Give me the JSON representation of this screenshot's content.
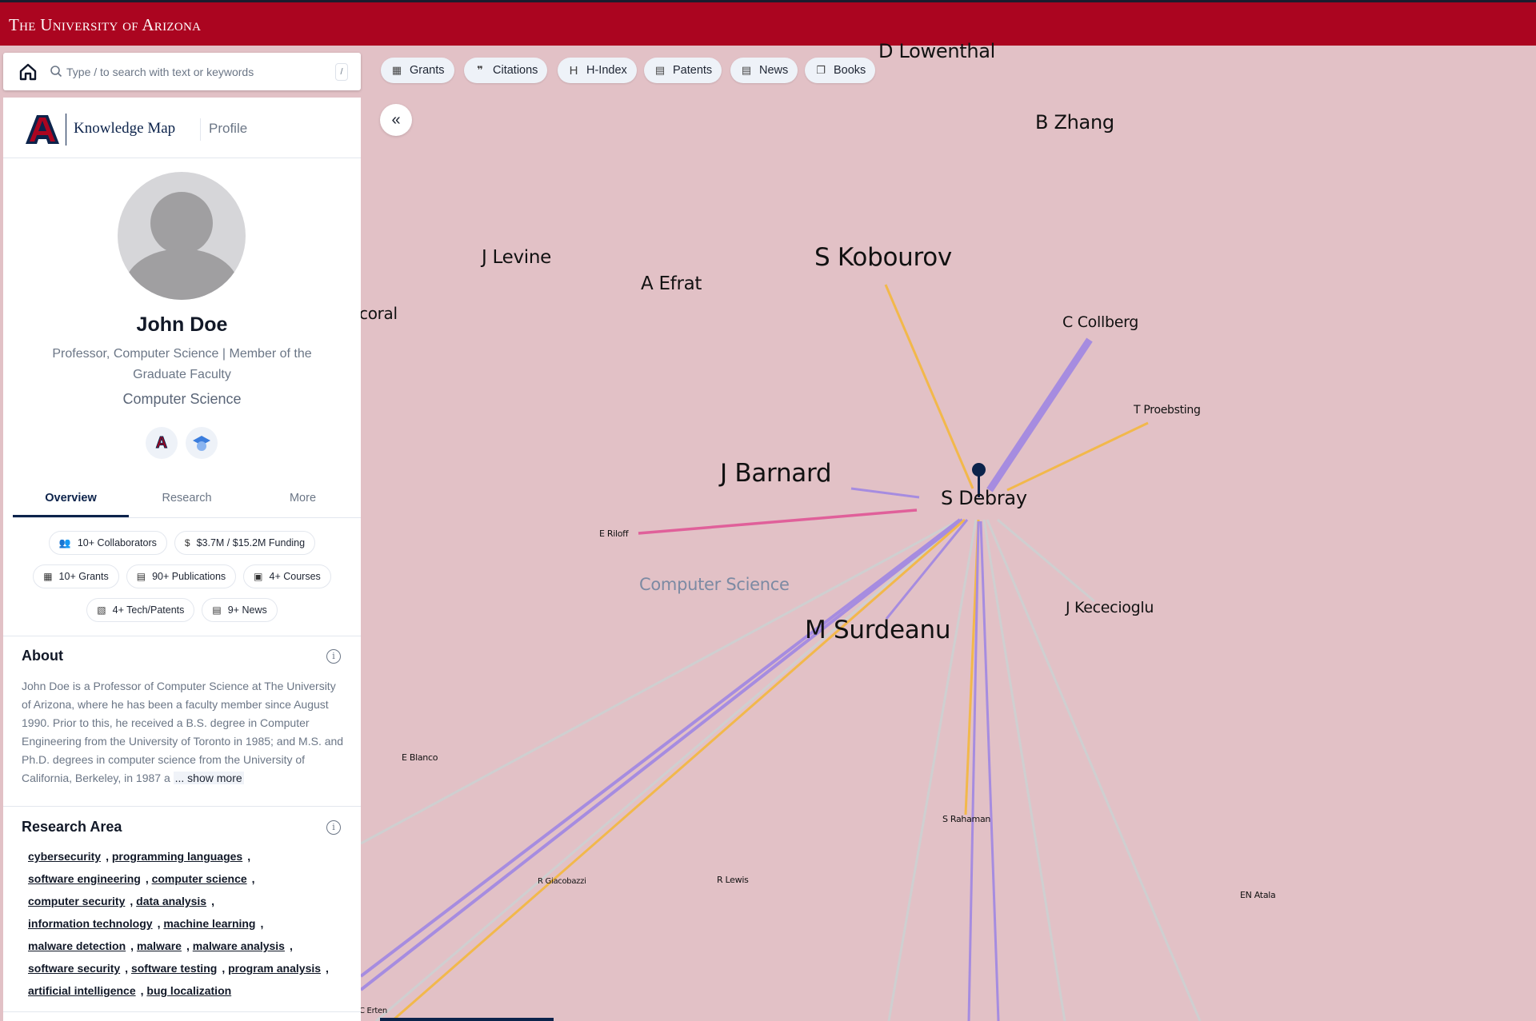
{
  "header": {
    "brand": "The University of Arizona"
  },
  "search": {
    "placeholder": "Type / to search with text or keywords",
    "value": "",
    "shortcut": "/"
  },
  "logo": {
    "app_name": "Knowledge Map",
    "section": "Profile"
  },
  "profile": {
    "name": "John Doe",
    "title": "Professor, Computer Science | Member of the Graduate Faculty",
    "department": "Computer Science",
    "badges": [
      "arizona-a-icon",
      "graduation-cap-icon"
    ]
  },
  "tabs": [
    {
      "label": "Overview",
      "active": true
    },
    {
      "label": "Research",
      "active": false
    },
    {
      "label": "More",
      "active": false
    }
  ],
  "stats": [
    {
      "icon": "collaborators-icon",
      "label": "10+ Collaborators"
    },
    {
      "icon": "dollar-icon",
      "label": "$3.7M / $15.2M Funding"
    },
    {
      "icon": "grants-icon",
      "label": "10+ Grants"
    },
    {
      "icon": "publications-icon",
      "label": "90+ Publications"
    },
    {
      "icon": "courses-icon",
      "label": "4+ Courses"
    },
    {
      "icon": "patents-icon",
      "label": "4+ Tech/Patents"
    },
    {
      "icon": "news-icon",
      "label": "9+ News"
    }
  ],
  "about": {
    "heading": "About",
    "text": "John Doe is a Professor of Computer Science at The University of Arizona, where he has been a faculty member since August 1990. Prior to this, he received a B.S. degree in Computer Engineering from the University of Toronto in 1985; and M.S. and Ph.D. degrees in computer science from the University of California, Berkeley, in 1987 a",
    "show_more": "... show more"
  },
  "research_area": {
    "heading": "Research Area",
    "tags": [
      "cybersecurity",
      "programming languages",
      "software engineering",
      "computer science",
      "computer security",
      "data analysis",
      "information technology",
      "machine learning",
      "malware detection",
      "malware",
      "malware analysis",
      "software security",
      "software testing",
      "program analysis",
      "artificial intelligence",
      "bug localization"
    ]
  },
  "toolbar": [
    {
      "icon": "grants-icon",
      "label": "Grants"
    },
    {
      "icon": "quote-icon",
      "label": "Citations"
    },
    {
      "icon": "h-icon",
      "label": "H-Index"
    },
    {
      "icon": "patent-icon",
      "label": "Patents"
    },
    {
      "icon": "news-icon",
      "label": "News"
    },
    {
      "icon": "books-icon",
      "label": "Books"
    }
  ],
  "map": {
    "center_node": "S Debray",
    "cluster_label": "Computer Science",
    "nodes": [
      "D Lowenthal",
      "B Zhang",
      "J Levine",
      "A Efrat",
      "S Kobourov",
      "coral",
      "C Collberg",
      "T Proebsting",
      "J Barnard",
      "E Riloff",
      "J Kececioglu",
      "M Surdeanu",
      "E Blanco",
      "S Rahaman",
      "R Giacobazzi",
      "R Lewis",
      "EN Atala",
      "C Erten"
    ],
    "colors": {
      "background": "#e2c1c6",
      "header": "#ab0520",
      "purple_edge": "#a68ce0",
      "orange_edge": "#f2b84b",
      "pink_edge": "#e0609a",
      "gray_edge": "#cfcfd0",
      "node_pin": "#0c234b"
    }
  }
}
